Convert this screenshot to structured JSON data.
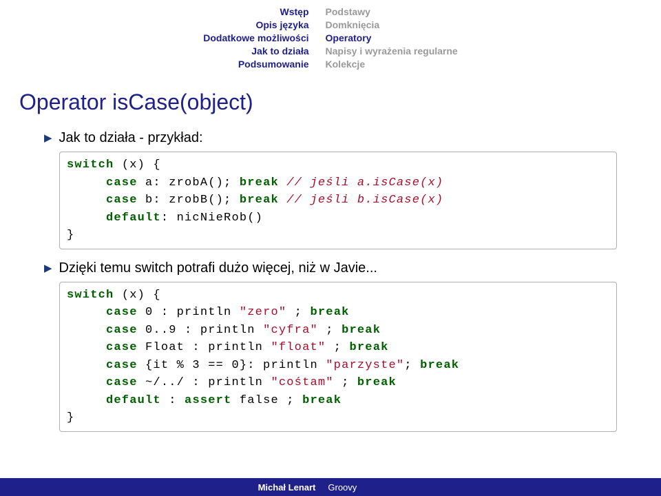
{
  "nav_left": [
    "Wstęp",
    "Opis języka",
    "Dodatkowe możliwości",
    "Jak to działa",
    "Podsumowanie"
  ],
  "nav_right": [
    {
      "label": "Podstawy",
      "active": false
    },
    {
      "label": "Domknięcia",
      "active": false
    },
    {
      "label": "Operatory",
      "active": true
    },
    {
      "label": "Napisy i wyrażenia regularne",
      "active": false
    },
    {
      "label": "Kolekcje",
      "active": false
    }
  ],
  "title": "Operator isCase(object)",
  "bullet1": "Jak to działa - przykład:",
  "code1": {
    "l1a": "switch",
    "l1b": " (x) {",
    "l2a": "     case",
    "l2b": " a: zrobA(); ",
    "l2c": "break",
    "l2d": " ",
    "l2e": "// jeśli a.isCase(x)",
    "l3a": "     case",
    "l3b": " b: zrobB(); ",
    "l3c": "break",
    "l3d": " ",
    "l3e": "// jeśli b.isCase(x)",
    "l4a": "     default",
    "l4b": ": nicNieRob()",
    "l5": "}"
  },
  "bullet2": "Dzięki temu switch potrafi dużo więcej, niż w Javie...",
  "code2": {
    "l1a": "switch",
    "l1b": " (x) {",
    "l2a": "     case",
    "l2b": " 0 : println ",
    "l2c": "\"zero\"",
    "l2d": " ; ",
    "l2e": "break",
    "l3a": "     case",
    "l3b": " 0..9 : println ",
    "l3c": "\"cyfra\"",
    "l3d": " ; ",
    "l3e": "break",
    "l4a": "     case",
    "l4b": " Float : println ",
    "l4c": "\"float\"",
    "l4d": " ; ",
    "l4e": "break",
    "l5a": "     case",
    "l5b": " {it % 3 == 0}: println ",
    "l5c": "\"parzyste\"",
    "l5d": "; ",
    "l5e": "break",
    "l6a": "     case",
    "l6b": " ~/../ : println ",
    "l6c": "\"cośtam\"",
    "l6d": " ; ",
    "l6e": "break",
    "l7a": "     default",
    "l7b": " : ",
    "l7c": "assert",
    "l7d": " false ; ",
    "l7e": "break",
    "l8": "}"
  },
  "footer": {
    "author": "Michał Lenart",
    "proj": "Groovy"
  }
}
